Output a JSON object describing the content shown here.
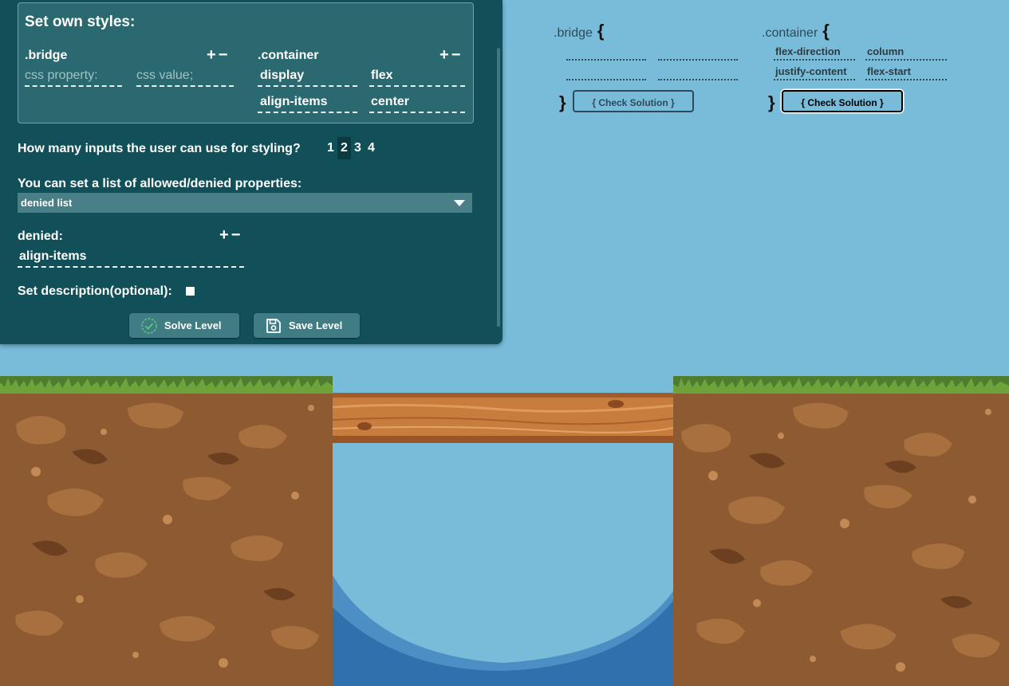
{
  "editor": {
    "styles_title": "Set own styles:",
    "bridge_rule": {
      "selector": ".bridge",
      "plus": "+",
      "minus": "−",
      "property_placeholder": "css property:",
      "value_placeholder": "css value;"
    },
    "container_rule": {
      "selector": ".container",
      "plus": "+",
      "minus": "−",
      "rows": [
        {
          "property": "display",
          "value": "flex"
        },
        {
          "property": "align-items",
          "value": "center"
        }
      ]
    },
    "inputs_question": "How many inputs the user can use for styling?",
    "input_counts": [
      "1",
      "2",
      "3",
      "4"
    ],
    "input_count_selected": "2",
    "list_question": "You can set a list of allowed/denied properties:",
    "list_mode": "denied list",
    "denied_label": "denied:",
    "denied_plus": "+",
    "denied_minus": "−",
    "denied_items": [
      "align-items"
    ],
    "description_label": "Set description(optional):",
    "description_checked": false,
    "solve_button": "Solve Level",
    "save_button": "Save Level"
  },
  "rules_preview": {
    "bridge": {
      "selector": ".bridge",
      "open_brace": "{",
      "close_brace": "}",
      "check_button": "{ Check Solution }"
    },
    "container": {
      "selector": ".container",
      "open_brace": "{",
      "close_brace": "}",
      "rows": [
        {
          "property": "flex-direction",
          "value": "column"
        },
        {
          "property": "justify-content",
          "value": "flex-start"
        }
      ],
      "check_button": "{ Check Solution }"
    }
  },
  "colors": {
    "sky": "#78bcd9",
    "panel": "#115059",
    "dirt": "#8d5a31",
    "water": "#2f70ad",
    "wood": "#c77d3e"
  }
}
